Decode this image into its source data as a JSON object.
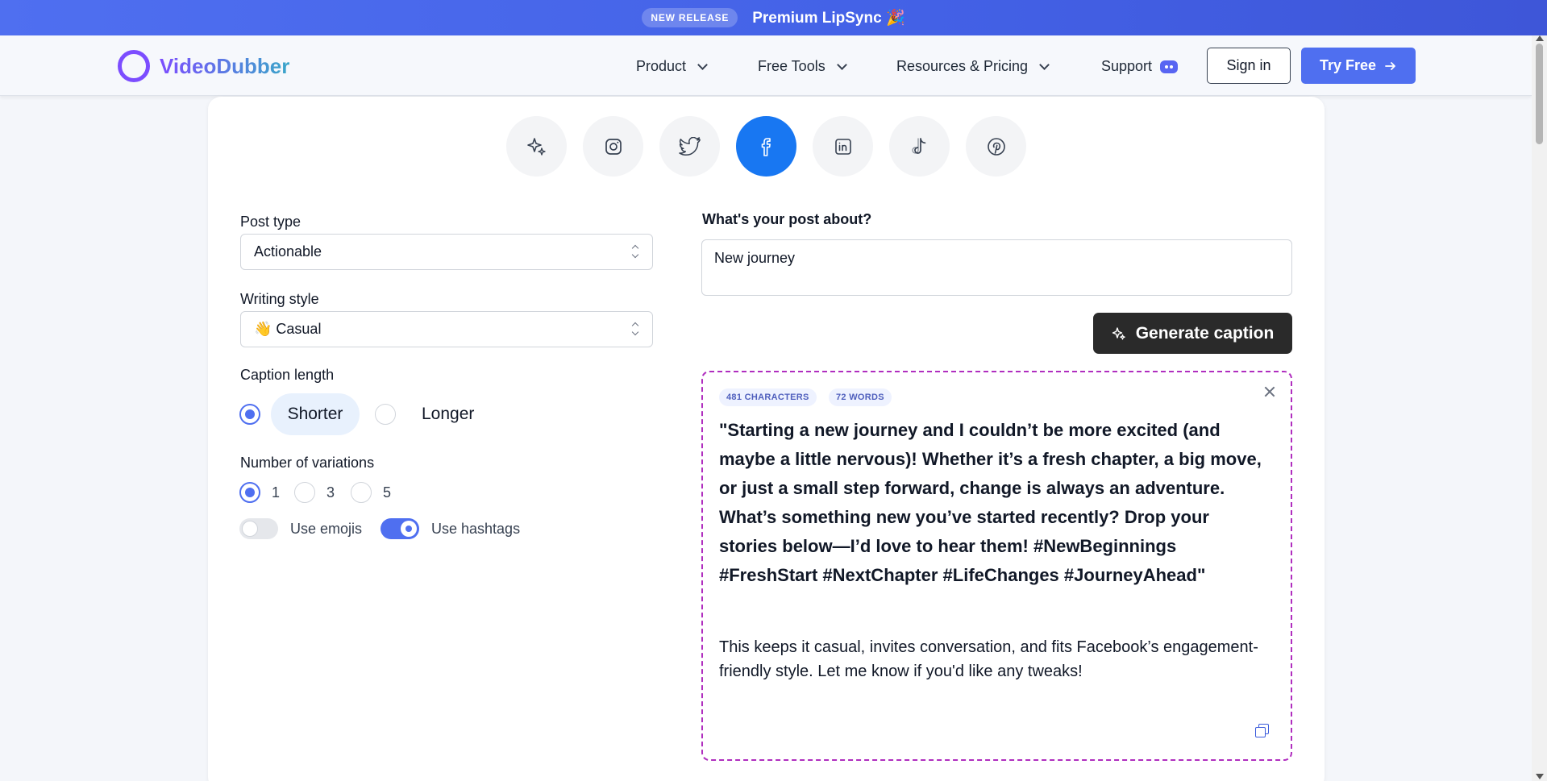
{
  "banner": {
    "badge": "NEW RELEASE",
    "text": "Premium LipSync 🎉"
  },
  "nav": {
    "logo": "VideoDubber",
    "items": [
      {
        "label": "Product"
      },
      {
        "label": "Free Tools"
      },
      {
        "label": "Resources & Pricing"
      },
      {
        "label": "Support"
      }
    ],
    "signin": "Sign in",
    "try_free": "Try Free"
  },
  "socials": [
    "sparkle-icon",
    "instagram-icon",
    "twitter-icon",
    "facebook-icon",
    "linkedin-icon",
    "tiktok-icon",
    "pinterest-icon"
  ],
  "active_social": "facebook-icon",
  "accent": "#4f6ff0",
  "form": {
    "post_type_label": "Post type",
    "post_type_value": "Actionable",
    "writing_style_label": "Writing style",
    "writing_style_value": "👋 Casual",
    "caption_length_label": "Caption length",
    "caption_length_options": [
      "Shorter",
      "Longer"
    ],
    "caption_length_selected": "Shorter",
    "variations_label": "Number of variations",
    "variations_options": [
      "1",
      "3",
      "5"
    ],
    "variations_selected": "1",
    "use_emojis_label": "Use emojis",
    "use_emojis": false,
    "use_hashtags_label": "Use hashtags",
    "use_hashtags": true
  },
  "post": {
    "about_label": "What's your post about?",
    "about_value": "New journey",
    "generate_label": "Generate caption"
  },
  "result": {
    "characters_tag": "481 CHARACTERS",
    "words_tag": "72 WORDS",
    "caption": "\"Starting a new journey and I couldn’t be more excited (and maybe a little nervous)! Whether it’s a fresh chapter, a big move, or just a small step forward, change is always an adventure. What’s something new you’ve started recently? Drop your stories below—I’d love to hear them! #NewBeginnings #FreshStart #NextChapter #LifeChanges #JourneyAhead\"",
    "note": "This keeps it casual, invites conversation, and fits Facebook’s engagement-friendly style. Let me know if you'd like any tweaks!"
  }
}
